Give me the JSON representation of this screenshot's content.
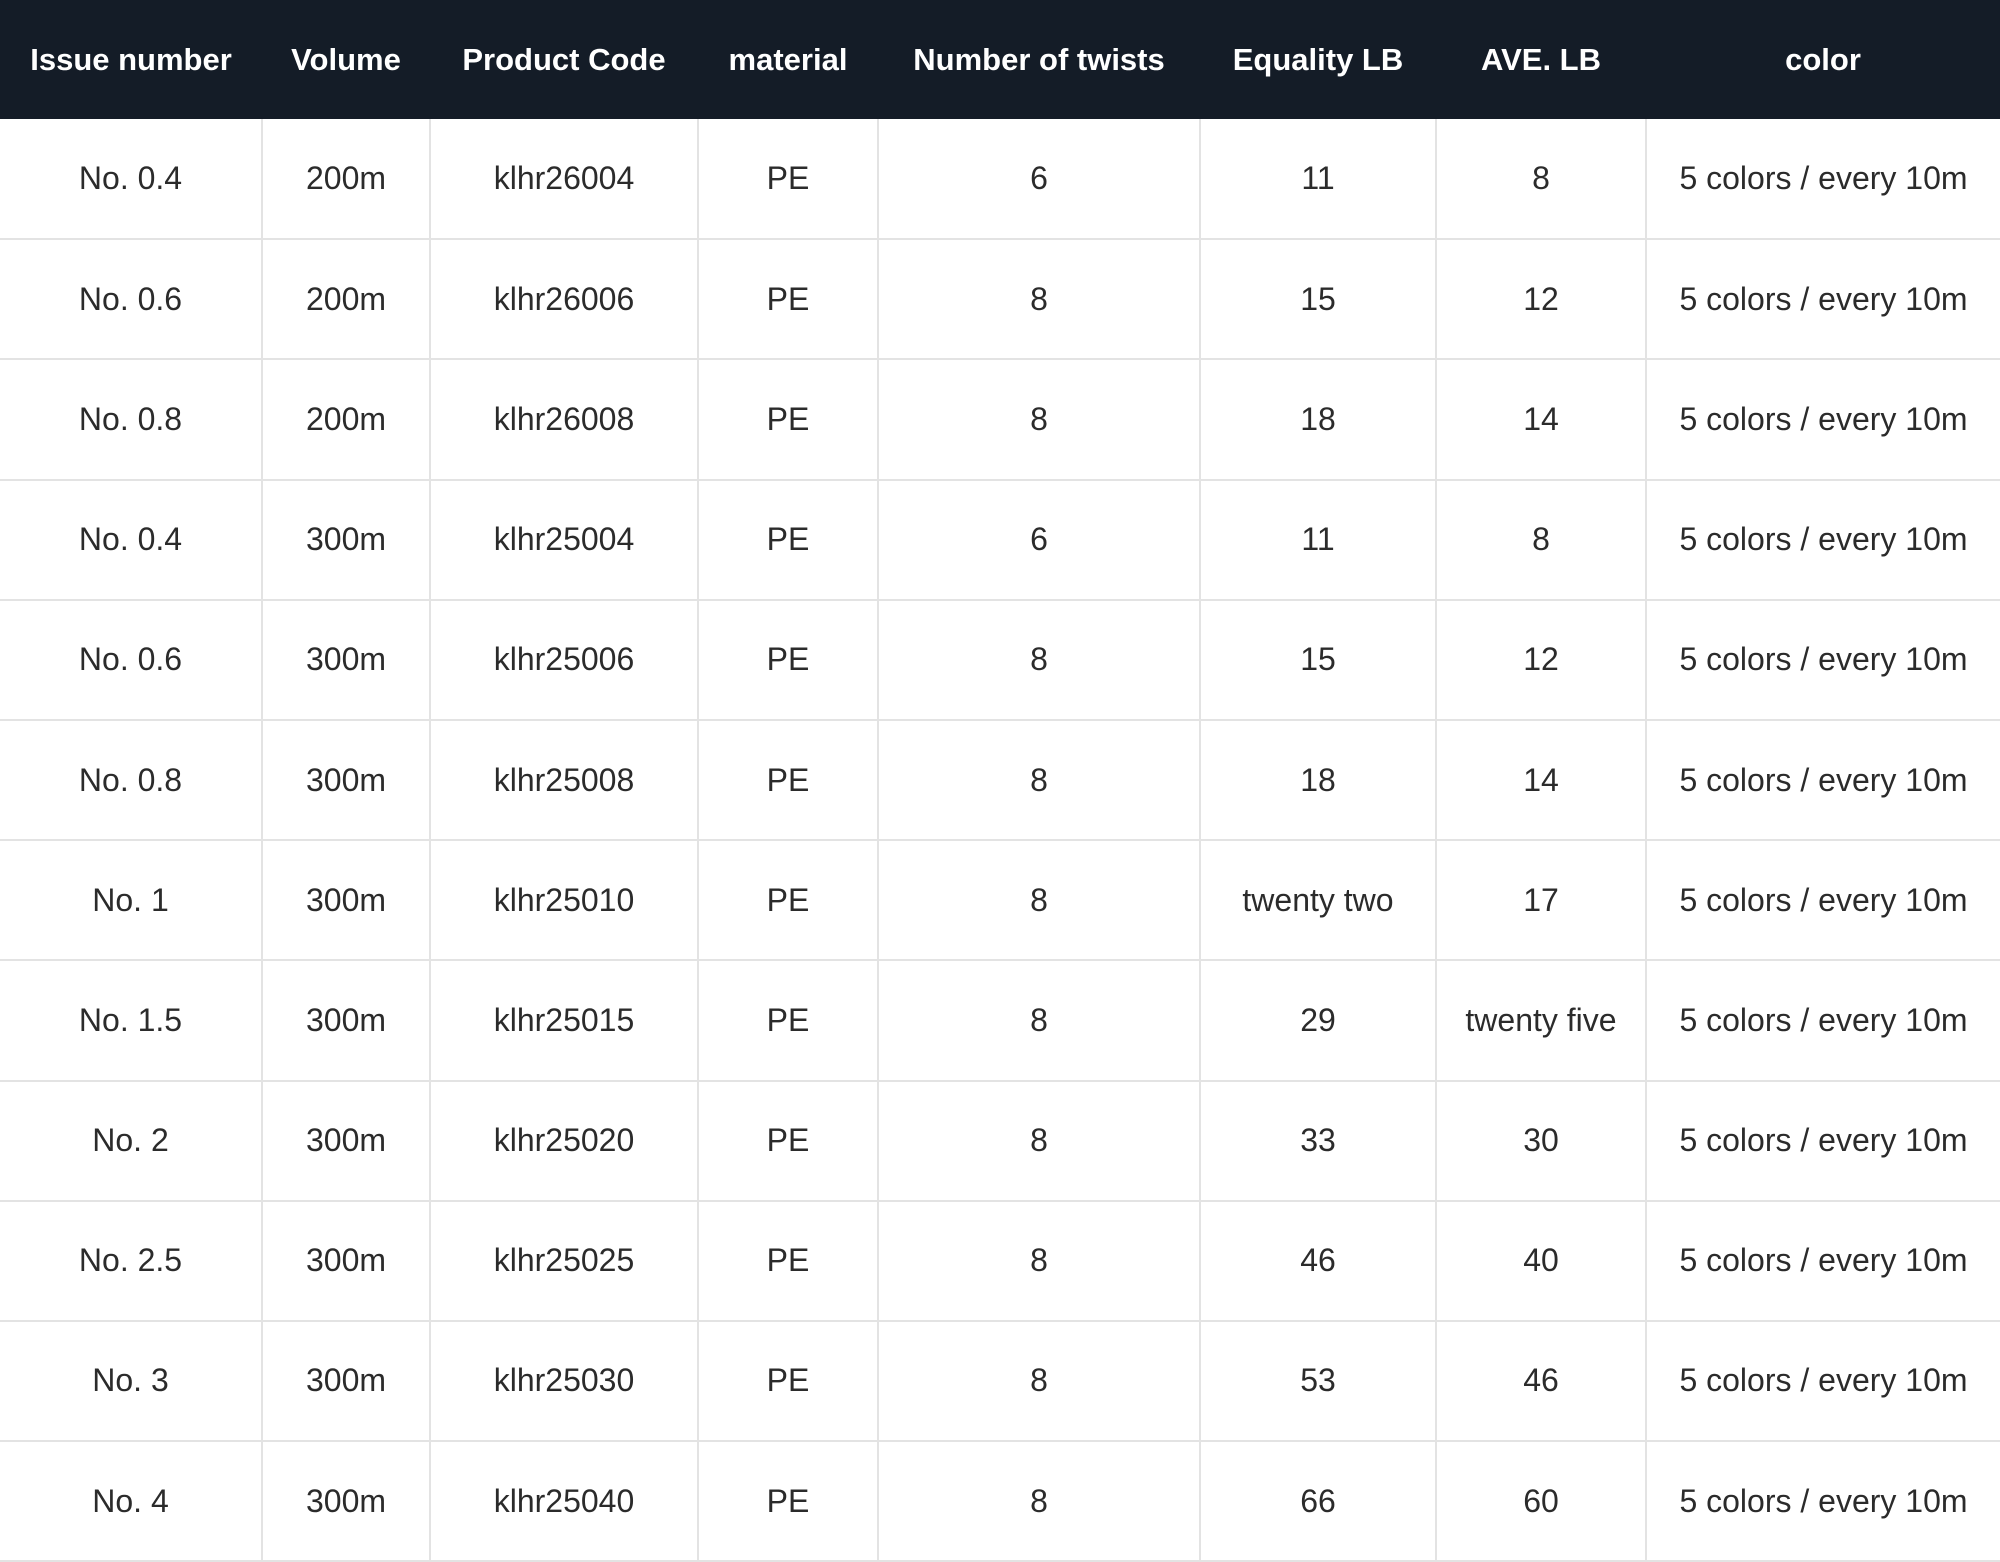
{
  "table": {
    "columns": [
      "Issue number",
      "Volume",
      "Product Code",
      "material",
      "Number of twists",
      "Equality LB",
      "AVE. LB",
      "color"
    ],
    "rows": [
      [
        "No. 0.4",
        "200m",
        "klhr26004",
        "PE",
        "6",
        "11",
        "8",
        "5 colors / every 10m"
      ],
      [
        "No. 0.6",
        "200m",
        "klhr26006",
        "PE",
        "8",
        "15",
        "12",
        "5 colors / every 10m"
      ],
      [
        "No. 0.8",
        "200m",
        "klhr26008",
        "PE",
        "8",
        "18",
        "14",
        "5 colors / every 10m"
      ],
      [
        "No. 0.4",
        "300m",
        "klhr25004",
        "PE",
        "6",
        "11",
        "8",
        "5 colors / every 10m"
      ],
      [
        "No. 0.6",
        "300m",
        "klhr25006",
        "PE",
        "8",
        "15",
        "12",
        "5 colors / every 10m"
      ],
      [
        "No. 0.8",
        "300m",
        "klhr25008",
        "PE",
        "8",
        "18",
        "14",
        "5 colors / every 10m"
      ],
      [
        "No. 1",
        "300m",
        "klhr25010",
        "PE",
        "8",
        "twenty two",
        "17",
        "5 colors / every 10m"
      ],
      [
        "No. 1.5",
        "300m",
        "klhr25015",
        "PE",
        "8",
        "29",
        "twenty five",
        "5 colors / every 10m"
      ],
      [
        "No. 2",
        "300m",
        "klhr25020",
        "PE",
        "8",
        "33",
        "30",
        "5 colors / every 10m"
      ],
      [
        "No. 2.5",
        "300m",
        "klhr25025",
        "PE",
        "8",
        "46",
        "40",
        "5 colors / every 10m"
      ],
      [
        "No. 3",
        "300m",
        "klhr25030",
        "PE",
        "8",
        "53",
        "46",
        "5 colors / every 10m"
      ],
      [
        "No. 4",
        "300m",
        "klhr25040",
        "PE",
        "8",
        "66",
        "60",
        "5 colors / every 10m"
      ]
    ]
  },
  "colors": {
    "header_background": "#141c27",
    "header_text": "#ffffff",
    "body_text": "#2b2b2b",
    "grid_line": "#e3e3e3"
  }
}
